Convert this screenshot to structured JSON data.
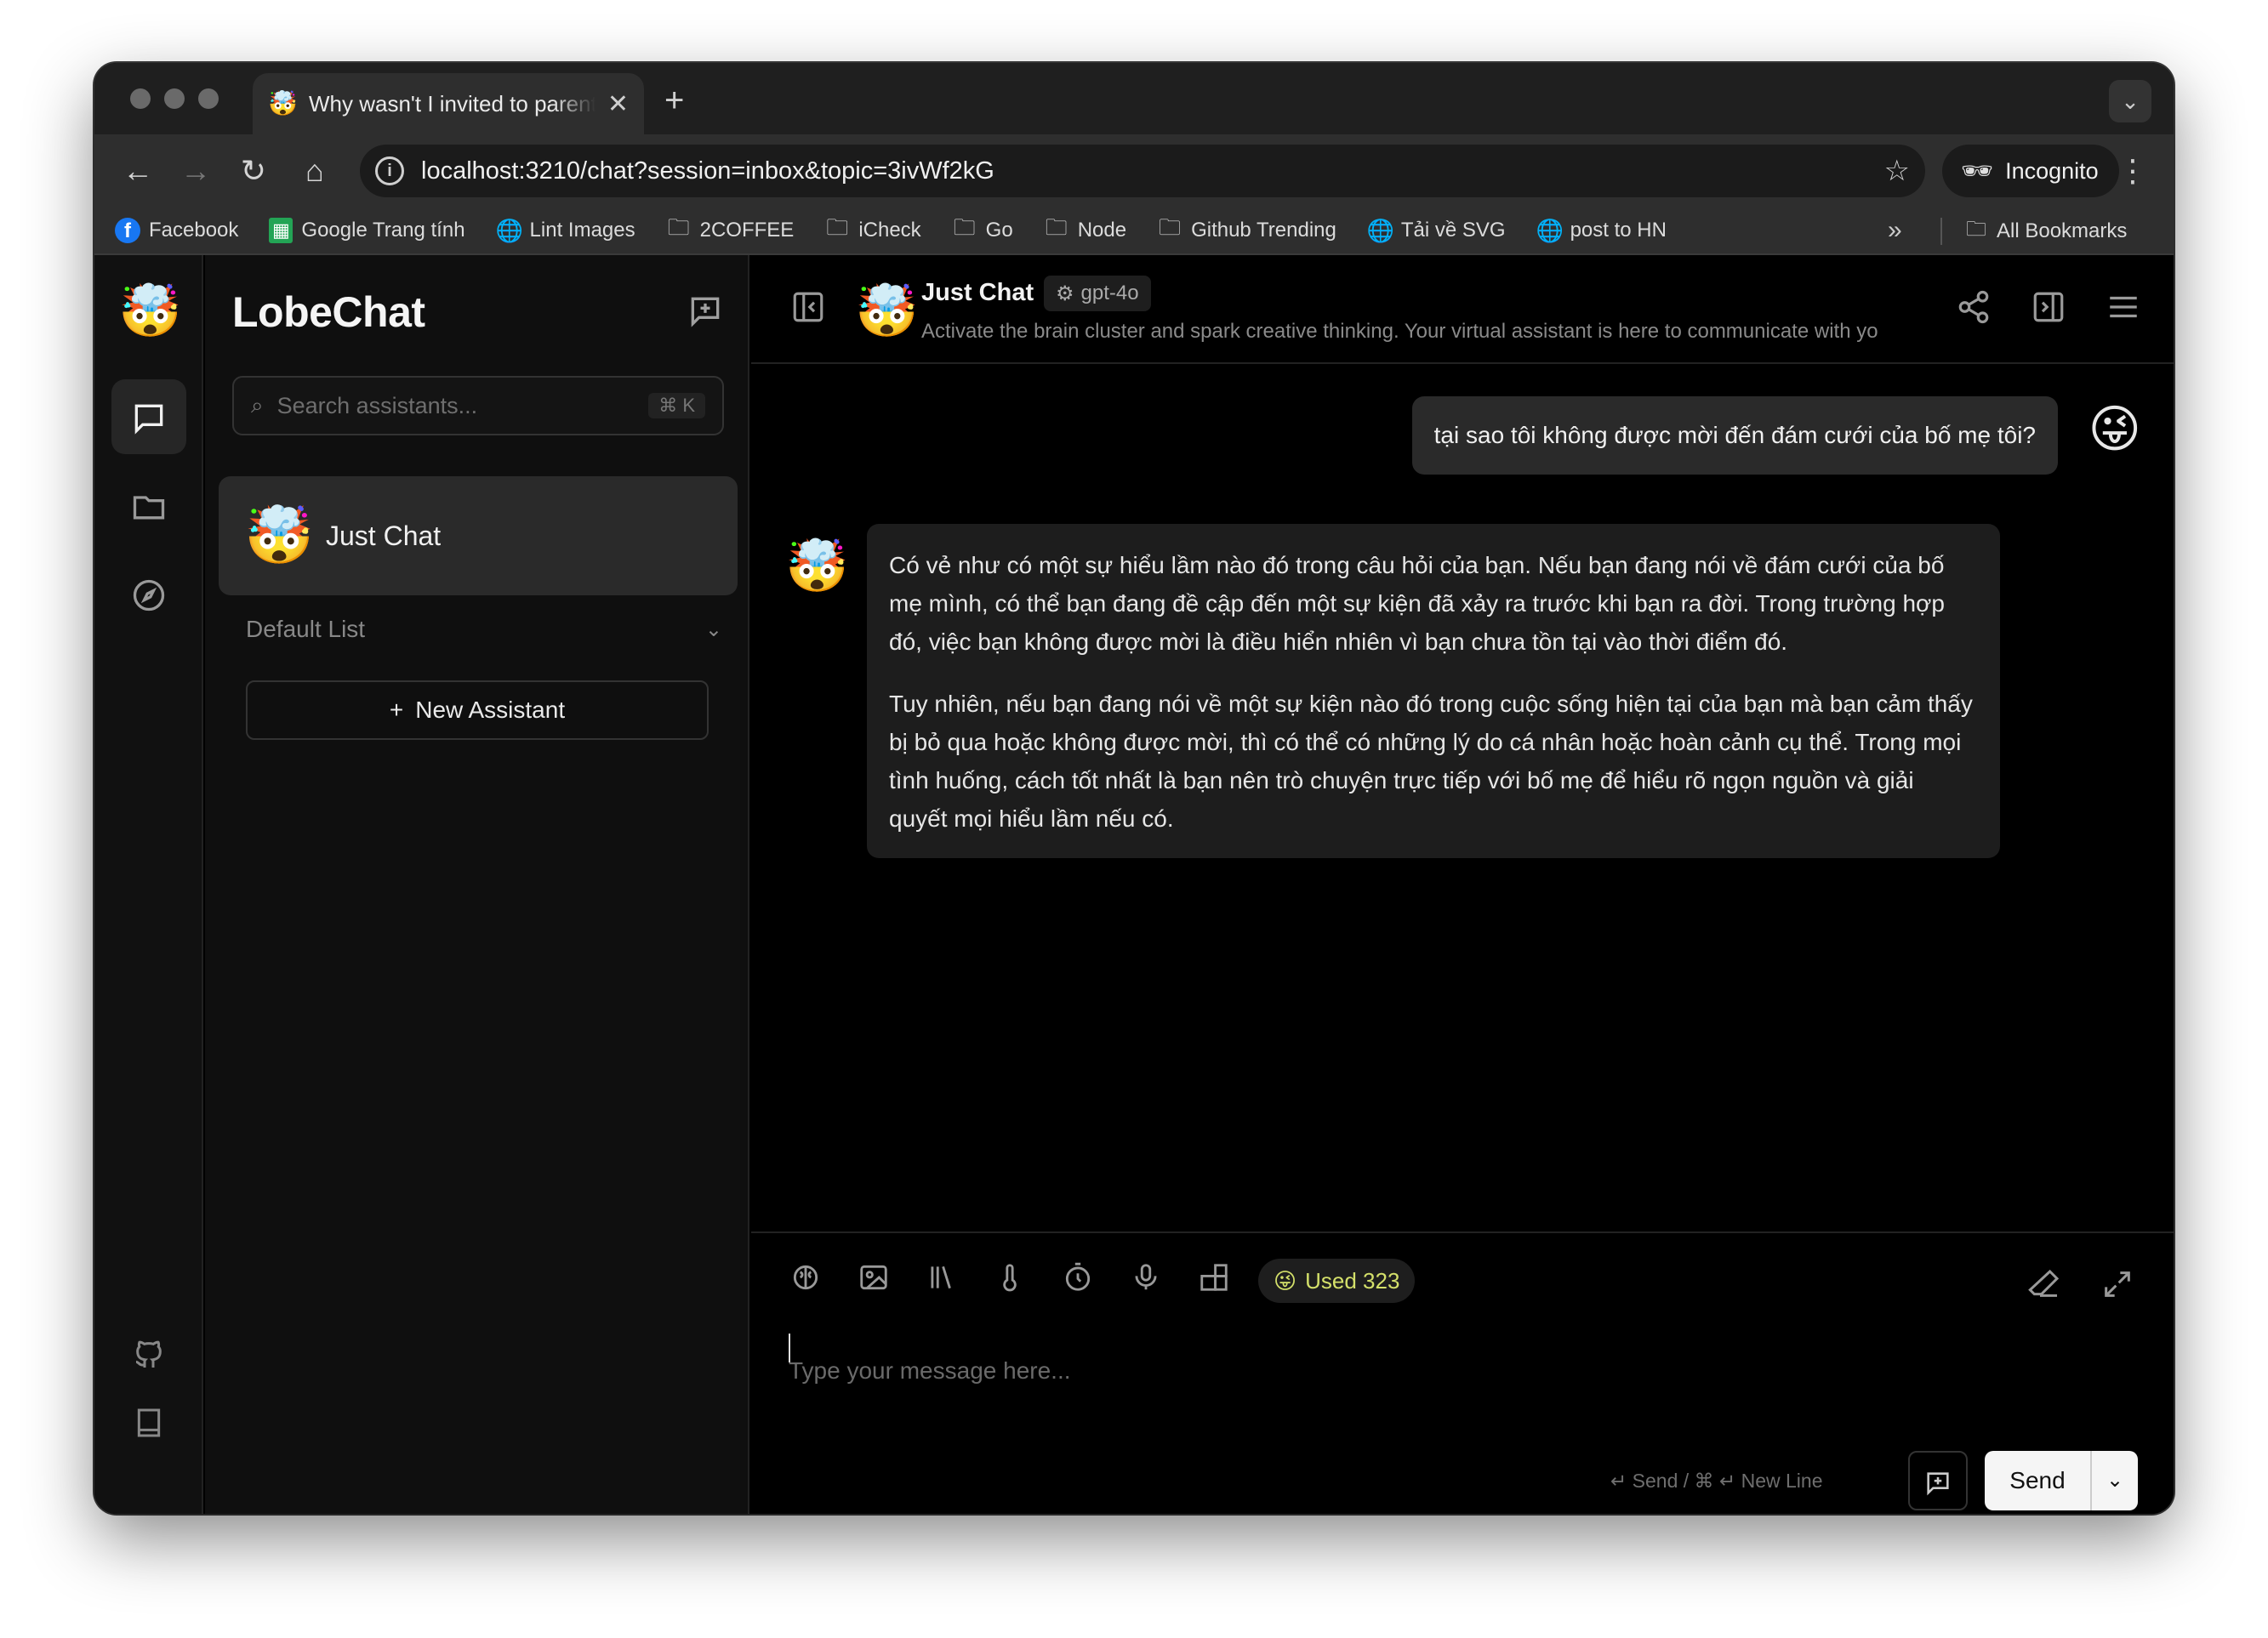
{
  "browser": {
    "tab_title": "Why wasn't I invited to parent",
    "tab_favicon": "🤯",
    "new_tab": "+",
    "url": "localhost:3210/chat?session=inbox&topic=3ivWf2kG",
    "incognito_label": "Incognito",
    "bookmarks": [
      {
        "label": "Facebook",
        "icon": "facebook-icon"
      },
      {
        "label": "Google Trang tính",
        "icon": "google-sheets-icon"
      },
      {
        "label": "Lint Images",
        "icon": "globe-icon"
      },
      {
        "label": "2COFFEE",
        "icon": "folder-icon"
      },
      {
        "label": "iCheck",
        "icon": "folder-icon"
      },
      {
        "label": "Go",
        "icon": "folder-icon"
      },
      {
        "label": "Node",
        "icon": "folder-icon"
      },
      {
        "label": "Github Trending",
        "icon": "folder-icon"
      },
      {
        "label": "Tải về SVG",
        "icon": "globe-icon"
      },
      {
        "label": "post to HN",
        "icon": "globe-icon"
      }
    ],
    "all_bookmarks": "All Bookmarks"
  },
  "sidebar": {
    "app_name": "LobeChat",
    "search_placeholder": "Search assistants...",
    "search_shortcut": "⌘ K",
    "sessions": [
      {
        "name": "Just Chat",
        "avatar": "🤯"
      }
    ],
    "group_label": "Default List",
    "new_assistant_label": "New Assistant"
  },
  "chat": {
    "title": "Just Chat",
    "model": "gpt-4o",
    "description": "Activate the brain cluster and spark creative thinking. Your virtual assistant is here to communicate with yo",
    "avatar": "🤯",
    "user_avatar": "😜",
    "user_message": "tại sao tôi không được mời đến đám cưới của bố mẹ tôi?",
    "assistant_paragraphs": [
      "Có vẻ như có một sự hiểu lầm nào đó trong câu hỏi của bạn. Nếu bạn đang nói về đám cưới của bố mẹ mình, có thể bạn đang đề cập đến một sự kiện đã xảy ra trước khi bạn ra đời. Trong trường hợp đó, việc bạn không được mời là điều hiển nhiên vì bạn chưa tồn tại vào thời điểm đó.",
      "Tuy nhiên, nếu bạn đang nói về một sự kiện nào đó trong cuộc sống hiện tại của bạn mà bạn cảm thấy bị bỏ qua hoặc không được mời, thì có thể có những lý do cá nhân hoặc hoàn cảnh cụ thể. Trong mọi tình huống, cách tốt nhất là bạn nên trò chuyện trực tiếp với bố mẹ để hiểu rõ ngọn nguồn và giải quyết mọi hiểu lầm nếu có."
    ]
  },
  "composer": {
    "used_label": "Used 323",
    "placeholder": "Type your message here...",
    "hint": "↵ Send / ⌘ ↵ New Line",
    "send_label": "Send"
  }
}
